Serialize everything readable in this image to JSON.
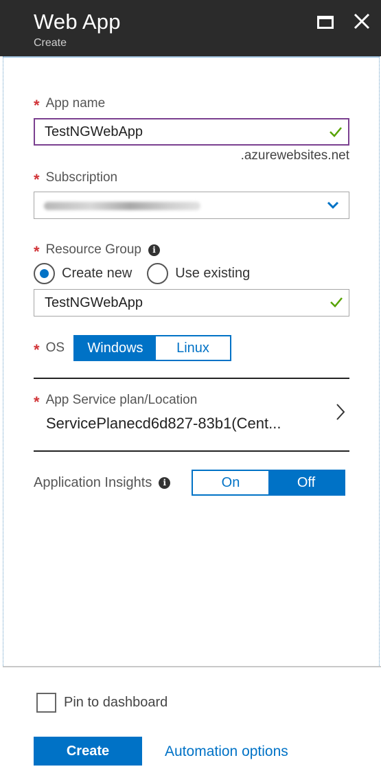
{
  "header": {
    "title": "Web App",
    "subtitle": "Create",
    "maximize_icon": "maximize-icon",
    "close_icon": "close-icon"
  },
  "app_name": {
    "label": "App name",
    "required": true,
    "value": "TestNGWebApp",
    "valid_icon": "checkmark-icon",
    "suffix": ".azurewebsites.net"
  },
  "subscription": {
    "label": "Subscription",
    "required": true,
    "value_redacted": true,
    "dropdown_icon": "chevron-down-icon"
  },
  "resource_group": {
    "label": "Resource Group",
    "required": true,
    "info_icon": "info-icon",
    "options": [
      "Create new",
      "Use existing"
    ],
    "selected": "Create new",
    "value": "TestNGWebApp",
    "valid_icon": "checkmark-icon"
  },
  "os": {
    "label": "OS",
    "required": true,
    "options": [
      "Windows",
      "Linux"
    ],
    "selected": "Windows"
  },
  "app_service_plan": {
    "label": "App Service plan/Location",
    "required": true,
    "value": "ServicePlanecd6d827-83b1(Cent...",
    "chevron_icon": "chevron-right-icon"
  },
  "application_insights": {
    "label": "Application Insights",
    "info_icon": "info-icon",
    "options": [
      "On",
      "Off"
    ],
    "selected": "Off"
  },
  "footer": {
    "pin_label": "Pin to dashboard",
    "pin_checked": false,
    "create_label": "Create",
    "automation_label": "Automation options"
  },
  "colors": {
    "accent": "#0072c6",
    "header_bg": "#2b2b2b",
    "required": "#d13438",
    "valid": "#57a300",
    "focus_border": "#7a3f8f"
  }
}
